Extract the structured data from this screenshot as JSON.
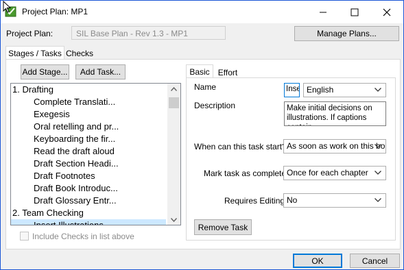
{
  "window": {
    "title": "Project Plan: MP1"
  },
  "project_plan": {
    "label": "Project Plan:",
    "value": "SIL Base Plan - Rev 1.3 - MP1",
    "manage_button": "Manage Plans..."
  },
  "outer_tabs": [
    "Stages / Tasks",
    "Checks"
  ],
  "buttons": {
    "add_stage": "Add Stage...",
    "add_task": "Add Task...",
    "remove_task": "Remove Task",
    "ok": "OK",
    "cancel": "Cancel"
  },
  "list": {
    "items": [
      {
        "text": "1. Drafting",
        "kind": "stage"
      },
      {
        "text": "Complete Translati...",
        "kind": "task"
      },
      {
        "text": "Exegesis",
        "kind": "task"
      },
      {
        "text": "Oral retelling and pr...",
        "kind": "task"
      },
      {
        "text": "Keyboarding the fir...",
        "kind": "task"
      },
      {
        "text": "Read the draft aloud",
        "kind": "task"
      },
      {
        "text": "Draft Section Headi...",
        "kind": "task"
      },
      {
        "text": "Draft Footnotes",
        "kind": "task"
      },
      {
        "text": "Draft Book Introduc...",
        "kind": "task"
      },
      {
        "text": "Draft Glossary Entr...",
        "kind": "task"
      },
      {
        "text": "2. Team Checking",
        "kind": "stage"
      },
      {
        "text": "Insert Illustrations",
        "kind": "task",
        "selected": true
      }
    ]
  },
  "include_checks": {
    "label": "Include Checks in list above",
    "checked": false
  },
  "inner_tabs": [
    "Basic",
    "Effort"
  ],
  "form": {
    "name_label": "Name",
    "name_value": "Inse",
    "language": "English",
    "description_label": "Description",
    "description_value": "Make initial decisions on illustrations. If captions contain",
    "start_label": "When can this task start?",
    "start_value": "As soon as work on this bo",
    "complete_label": "Mark task as complete",
    "complete_value": "Once for each chapter",
    "editing_label": "Requires Editing",
    "editing_value": "No"
  },
  "colors": {
    "accent": "#0078d7",
    "selection": "#cce8ff",
    "window_border": "#1a56d6"
  }
}
